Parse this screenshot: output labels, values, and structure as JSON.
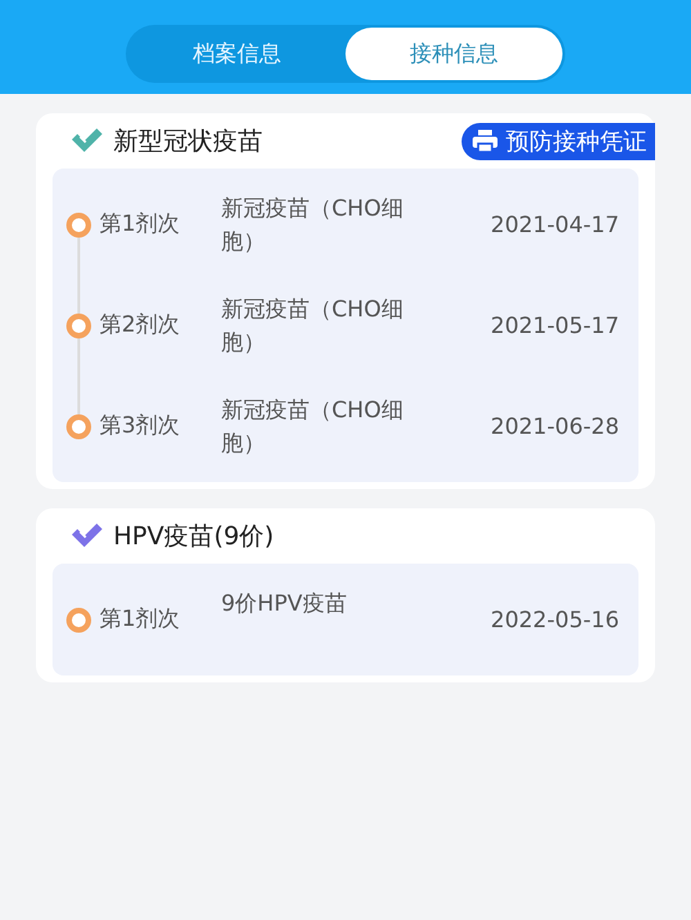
{
  "tabs": [
    {
      "label": "档案信息",
      "selected": false
    },
    {
      "label": "接种信息",
      "selected": true
    }
  ],
  "vaccines": [
    {
      "title": "新型冠状疫苗",
      "color": "#4fb3a9",
      "button": "预防接种凭证",
      "doses": [
        {
          "dose": "第1剂次",
          "name": "新冠疫苗（CHO细胞）",
          "date": "2021-04-17"
        },
        {
          "dose": "第2剂次",
          "name": "新冠疫苗（CHO细胞）",
          "date": "2021-05-17"
        },
        {
          "dose": "第3剂次",
          "name": "新冠疫苗（CHO细胞）",
          "date": "2021-06-28"
        }
      ]
    },
    {
      "title": "HPV疫苗(9价)",
      "color": "#7d72e8",
      "doses": [
        {
          "dose": "第1剂次",
          "name": "9价HPV疫苗",
          "date": "2022-05-16"
        }
      ]
    }
  ]
}
